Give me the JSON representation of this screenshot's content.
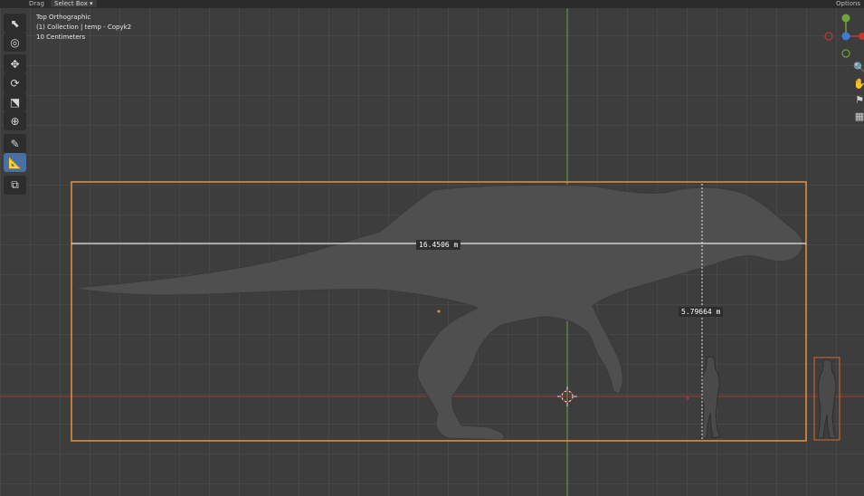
{
  "header": {
    "drag_label": "Drag",
    "select_box_label": "Select Box ▾",
    "options_label": "Options"
  },
  "viewport_info": {
    "view_name": "Top Orthographic",
    "collection": "(1) Collection | temp - Copyk2",
    "scale": "10 Centimeters"
  },
  "toolbar": {
    "tools": [
      {
        "name": "select-box",
        "icon": "cursor-arrow-icon",
        "active": false
      },
      {
        "name": "cursor",
        "icon": "3d-cursor-icon",
        "active": false
      },
      {
        "name": "move",
        "icon": "move-arrows-icon",
        "active": false
      },
      {
        "name": "rotate",
        "icon": "rotate-icon",
        "active": false
      },
      {
        "name": "scale",
        "icon": "scale-icon",
        "active": false
      },
      {
        "name": "transform",
        "icon": "transform-icon",
        "active": false
      },
      {
        "name": "annotate",
        "icon": "annotate-pen-icon",
        "active": false
      },
      {
        "name": "measure",
        "icon": "measure-ruler-icon",
        "active": true
      },
      {
        "name": "add-cube",
        "icon": "add-cube-icon",
        "active": false
      }
    ]
  },
  "measurements": {
    "length": "16.4506 m",
    "height": "5.79664 m"
  },
  "gizmo": {
    "axes": [
      "X",
      "Y",
      "Z"
    ]
  },
  "colors": {
    "selection_outline": "#e8913a",
    "x_axis": "#c0392b",
    "y_axis": "#71a33a",
    "active_tool": "#4a6fa4",
    "grid_bg": "#3d3d3d"
  }
}
